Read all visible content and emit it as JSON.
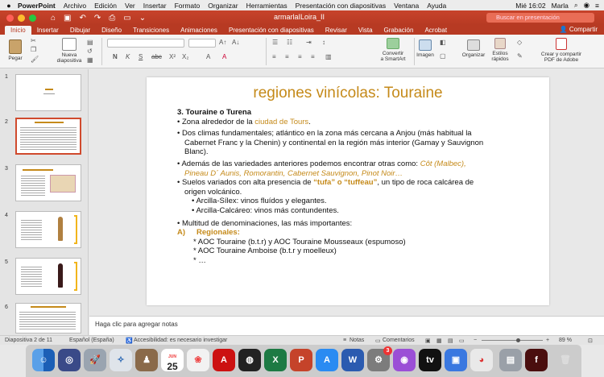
{
  "menubar": {
    "app_name": "PowerPoint",
    "items": [
      "Archivo",
      "Edición",
      "Ver",
      "Insertar",
      "Formato",
      "Organizar",
      "Herramientas",
      "Presentación con diapositivas",
      "Ventana",
      "Ayuda"
    ],
    "clock": "Mié 16:02",
    "user": "Marla"
  },
  "window": {
    "doc_title": "armarlaILoira_II",
    "search_placeholder": "Buscar en presentación"
  },
  "ribbon": {
    "tabs": [
      "Inicio",
      "Insertar",
      "Dibujar",
      "Diseño",
      "Transiciones",
      "Animaciones",
      "Presentación con diapositivas",
      "Revisar",
      "Vista",
      "Grabación",
      "Acrobat"
    ],
    "active_tab": "Inicio",
    "share_label": "Compartir",
    "paste_label": "Pegar",
    "new_slide_label_1": "Nueva",
    "new_slide_label_2": "diapositiva",
    "smartart_label_1": "Convertir",
    "smartart_label_2": "a SmartArt",
    "image_label": "Imagen",
    "arrange_label": "Organizar",
    "styles_label_1": "Estilos",
    "styles_label_2": "rápidos",
    "pdf_label_1": "Crear y compartir",
    "pdf_label_2": "PDF de Adobe"
  },
  "thumbnails": {
    "numbers": [
      "1",
      "2",
      "3",
      "4",
      "5",
      "6"
    ],
    "selected": 2
  },
  "slide": {
    "title": "regiones vinícolas: Touraine",
    "heading": "3. Touraine o Turena",
    "b1_pre": "Zona alrededor de la ",
    "b1_hl": "ciudad de Tours",
    "b1_post": ".",
    "b2_l1": "Dos climas fundamentales; atlántico en la zona más cercana a Anjou (más habitual la",
    "b2_l2": "Cabernet Franc y la Chenin) y continental en la región más interior (Gamay y Sauvignon",
    "b2_l3": "Blanc).",
    "b3_l1_pre": "Además de las variedades anteriores podemos encontrar otras como: ",
    "b3_l1_hl": "Côt (Malbec),",
    "b3_l2_hl": "Pineau D´ Aunis, Romorantin, Cabernet Sauvignon, Pinot Noir…",
    "b4_l1_pre": "Suelos variados con alta presencia de ",
    "b4_l1_hl": "“tufa” o “tuffeau”",
    "b4_l1_post": ", un tipo de roca calcárea de",
    "b4_l2": "origen volcánico.",
    "sub1": "Arcilla-Sílex: vinos fluídos y elegantes.",
    "sub2": "Arcilla-Calcáreo: vinos más contundentes.",
    "b5": "Multitud de denominaciones, las más importantes:",
    "a_label": "A)",
    "a_title": "Regionales:",
    "aoc1": "* AOC Touraine (b.t.r) y AOC Touraine Mousseaux (espumoso)",
    "aoc2": "* AOC Touraine Amboise (b.t.r y moelleux)",
    "aoc3": "* …"
  },
  "notes": {
    "placeholder": "Haga clic para agregar notas"
  },
  "status": {
    "slide_counter": "Diapositiva 2 de 11",
    "language": "Español (España)",
    "accessibility": "Accesibilidad: es necesario investigar",
    "notes_btn": "Notas",
    "comments_btn": "Comentarios",
    "zoom": "89 %"
  },
  "dock": {
    "calendar_day": "25",
    "calendar_month": "JUN",
    "badge_count": "3"
  },
  "colors": {
    "accent": "#b73a23",
    "slide_title": "#c58a1a"
  }
}
